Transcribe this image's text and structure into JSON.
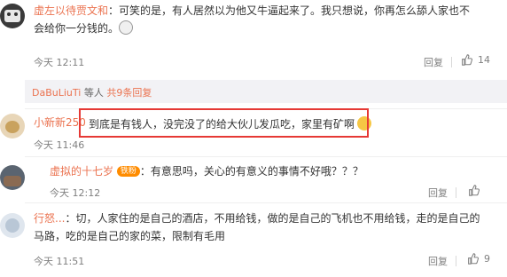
{
  "comments": [
    {
      "username": "虚左以待贾文和",
      "text_line1": "：可笑的是，有人居然以为他又牛逼起来了。我只想说，你再怎么舔人家也不",
      "text_line2": "会给你一分钱的。",
      "time": "今天 12:11",
      "reply": "回复",
      "likes": "14"
    },
    {
      "username": "小新新250",
      "text": "到底是有钱人，没完没了的给大伙儿发瓜吃，家里有矿啊",
      "time": "今天 11:46",
      "reply": "回复",
      "likes": ""
    },
    {
      "username": "虚拟的十七岁",
      "badge": "铁粉",
      "text": "：有意思吗，关心的有意义的事情不好哦？？？",
      "time": "今天 12:12",
      "reply": "回复",
      "likes": ""
    },
    {
      "username": "行怒...",
      "text_line1": "：切，人家住的是自己的酒店，不用给钱，做的是自己的飞机也不用给钱，走的是自己的",
      "text_line2": "马路，吃的是自己的家的菜，限制有毛用",
      "time": "今天 11:51",
      "reply": "回复",
      "likes": "9"
    }
  ],
  "subreplies": {
    "name": "DaBuLiuTi",
    "etc": " 等人 ",
    "total": "共9条回复"
  },
  "colors": {
    "username": "#eb7350",
    "highlight": "#e63935"
  }
}
